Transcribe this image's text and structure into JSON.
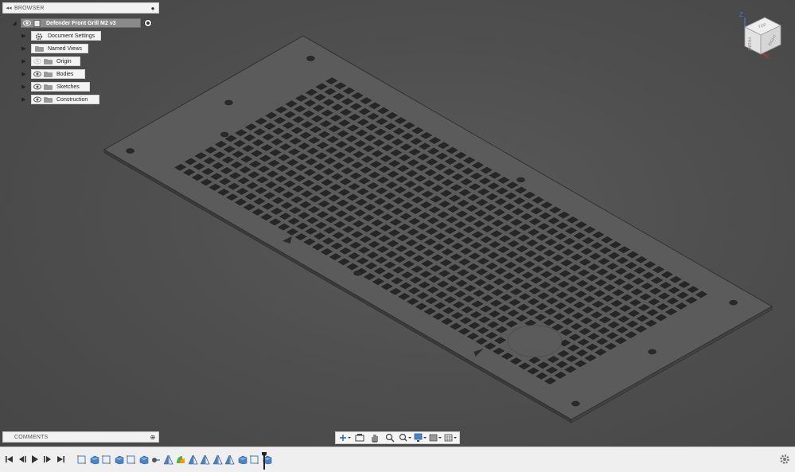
{
  "browser": {
    "title": "BROWSER",
    "root_label": "Defender Front Grill M2 v3",
    "items": [
      {
        "label": "Document Settings",
        "icon": "gear-icon",
        "eye": false
      },
      {
        "label": "Named Views",
        "icon": "folder-icon",
        "eye": false
      },
      {
        "label": "Origin",
        "icon": "folder-icon",
        "eye": true,
        "eye_hidden": true
      },
      {
        "label": "Bodies",
        "icon": "folder-icon",
        "eye": true,
        "eye_hidden": false
      },
      {
        "label": "Sketches",
        "icon": "folder-icon",
        "eye": true,
        "eye_hidden": false
      },
      {
        "label": "Construction",
        "icon": "folder-icon",
        "eye": true,
        "eye_hidden": false
      }
    ]
  },
  "comments": {
    "title": "COMMENTS"
  },
  "viewcube": {
    "top": "TOP",
    "front": "FRONT",
    "right": "RIGHT",
    "axis_z": "Z",
    "axis_x": "X"
  },
  "navbar": {
    "tools": [
      "orbit-icon",
      "look-at-icon",
      "pan-icon",
      "zoom-icon",
      "zoom-window-icon",
      "display-settings-icon",
      "visual-style-icon",
      "grid-settings-icon"
    ]
  },
  "timeline": {
    "controls": [
      "skip-to-start-icon",
      "step-back-icon",
      "play-icon",
      "step-forward-icon",
      "skip-to-end-icon"
    ],
    "features": [
      "sketch-icon",
      "extrude-icon",
      "sketch-icon",
      "extrude-icon",
      "sketch-icon",
      "extrude-icon",
      "move-icon",
      "mirror-icon",
      "pattern-icon",
      "mirror-icon",
      "mirror-icon",
      "mirror-icon",
      "mirror-icon",
      "extrude-icon",
      "sketch-icon",
      "extrude-icon"
    ]
  },
  "colors": {
    "background": "#4f4f4f",
    "plate": "#5b5b5b",
    "plate_edge": "#2a2a2a",
    "browser_root": "#8a8a8a",
    "timeline_accent": "#3a7fd0"
  }
}
